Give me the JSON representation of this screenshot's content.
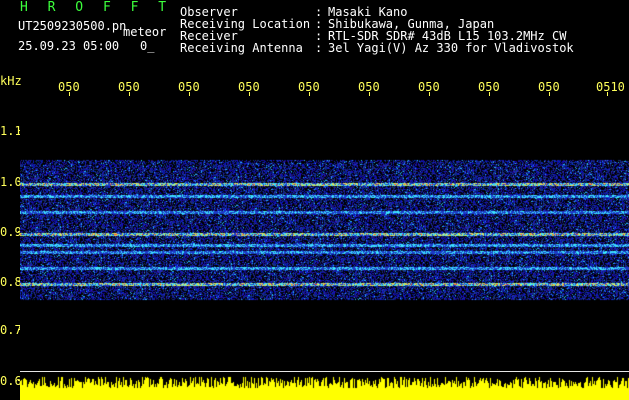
{
  "header": {
    "title": "H R O F F T",
    "filename": "UT2509230500.pn",
    "meteor_label": "meteor",
    "datetime": "25.09.23 05:00",
    "count": "0_",
    "fields": [
      {
        "label": "Observer",
        "value": "Masaki Kano"
      },
      {
        "label": "Receiving Location",
        "value": "Shibukawa, Gunma, Japan"
      },
      {
        "label": "Receiver",
        "value": "RTL-SDR SDR# 43dB L15 103.2MHz CW"
      },
      {
        "label": "Receiving Antenna",
        "value": "3el Yagi(V) Az 330 for Vladivostok"
      }
    ]
  },
  "axes": {
    "y_unit": "kHz",
    "x_ticks": [
      "050",
      "050",
      "050",
      "050",
      "050",
      "050",
      "050",
      "050",
      "050",
      "0510"
    ],
    "y_ticks": [
      "1.1",
      "1.0",
      "0.9",
      "0.8",
      "0.7",
      "0.6"
    ]
  },
  "colors": {
    "background": "#000000",
    "text_header": "#ffffff",
    "title": "#3cff3c",
    "axis": "#ffff5a",
    "noise": "#1020a0",
    "signal": "#ff3030",
    "bottom_bars": "#ffff00"
  }
}
